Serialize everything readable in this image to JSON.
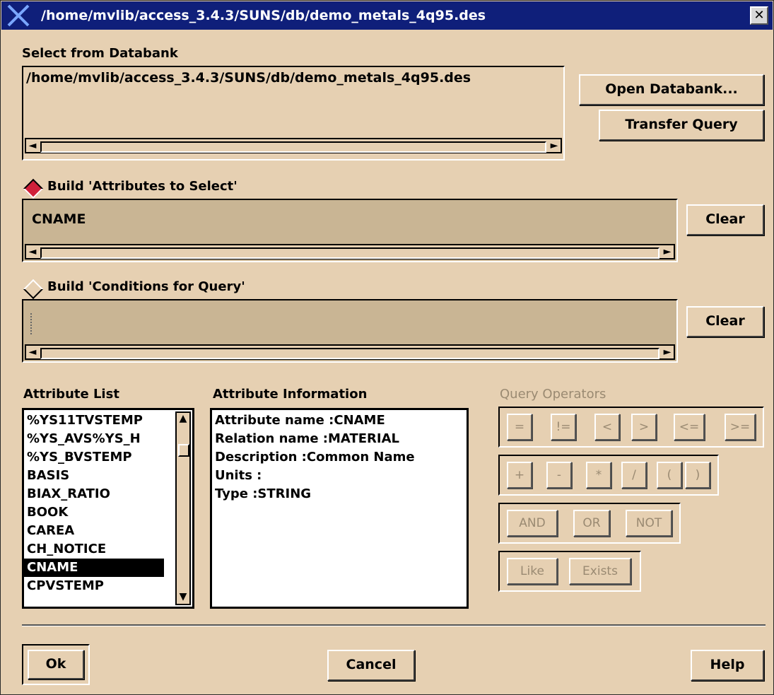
{
  "window": {
    "title": "/home/mvlib/access_3.4.3/SUNS/db/demo_metals_4q95.des",
    "close_glyph": "✕"
  },
  "databank": {
    "label": "Select from Databank",
    "path": "/home/mvlib/access_3.4.3/SUNS/db/demo_metals_4q95.des",
    "open_button": "Open Databank...",
    "transfer_button": "Transfer Query"
  },
  "attributes_select": {
    "label": "Build 'Attributes to Select'",
    "value": "CNAME",
    "clear": "Clear",
    "selected": true
  },
  "conditions": {
    "label": "Build 'Conditions for Query'",
    "value": "",
    "clear": "Clear",
    "selected": false
  },
  "attribute_list": {
    "label": "Attribute List",
    "items": [
      "%YS11TVSTEMP",
      "%YS_AVS%YS_H",
      "%YS_BVSTEMP",
      "BASIS",
      "BIAX_RATIO",
      "BOOK",
      "CAREA",
      "CH_NOTICE",
      "CNAME",
      "CPVSTEMP"
    ],
    "selected_index": 8
  },
  "attribute_info": {
    "label": "Attribute Information",
    "lines": [
      "Attribute name :CNAME",
      "Relation name :MATERIAL",
      "Description :Common Name",
      "Units :",
      "Type :STRING"
    ]
  },
  "query_operators": {
    "label": "Query Operators",
    "row1": [
      "=",
      "!=",
      "<",
      ">",
      "<=",
      ">="
    ],
    "row2": [
      "+",
      "-",
      "*",
      "/",
      "(",
      ")"
    ],
    "row3": [
      "AND",
      "OR",
      "NOT"
    ],
    "row4": [
      "Like",
      "Exists"
    ]
  },
  "footer": {
    "ok": "Ok",
    "cancel": "Cancel",
    "help": "Help"
  },
  "colors": {
    "background": "#e6d0b2",
    "titlebar": "#0f1f7a",
    "radio_on": "#d0203a",
    "disabled_text": "#9a8a72"
  }
}
